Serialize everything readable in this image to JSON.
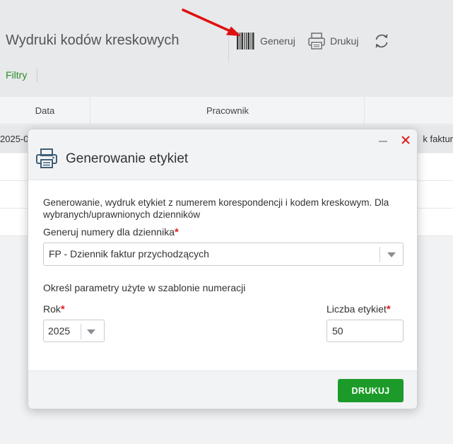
{
  "page": {
    "title": "Wydruki kodów kreskowych",
    "toolbar": {
      "generate_label": "Generuj",
      "print_label": "Drukuj",
      "generate_icon": "barcode-icon",
      "print_icon": "printer-icon",
      "refresh_icon": "refresh-icon"
    },
    "filters_label": "Filtry"
  },
  "table": {
    "columns": [
      "Data",
      "Pracownik"
    ],
    "rows": [
      {
        "date": "2025-0",
        "tail": "k faktur"
      }
    ]
  },
  "modal": {
    "title": "Generowanie etykiet",
    "icon": "printer-icon",
    "description": "Generowanie, wydruk etykiet z numerem korespondencji i kodem kreskowym. Dla wybranych/uprawnionych dzienników",
    "journal": {
      "label": "Generuj numery dla dziennika",
      "required_mark": "*",
      "value": "FP - Dziennik faktur przychodzących"
    },
    "params_text": "Określ parametry użyte w szablonie numeracji",
    "year": {
      "label": "Rok",
      "required_mark": "*",
      "value": "2025"
    },
    "count": {
      "label": "Liczba etykiet",
      "required_mark": "*",
      "value": "50"
    },
    "print_button": "DRUKUJ"
  },
  "colors": {
    "accent_green": "#1d9b2a",
    "filters_green": "#2a8a2a",
    "required_red": "#e02020",
    "annotation_arrow": "#e01010"
  }
}
